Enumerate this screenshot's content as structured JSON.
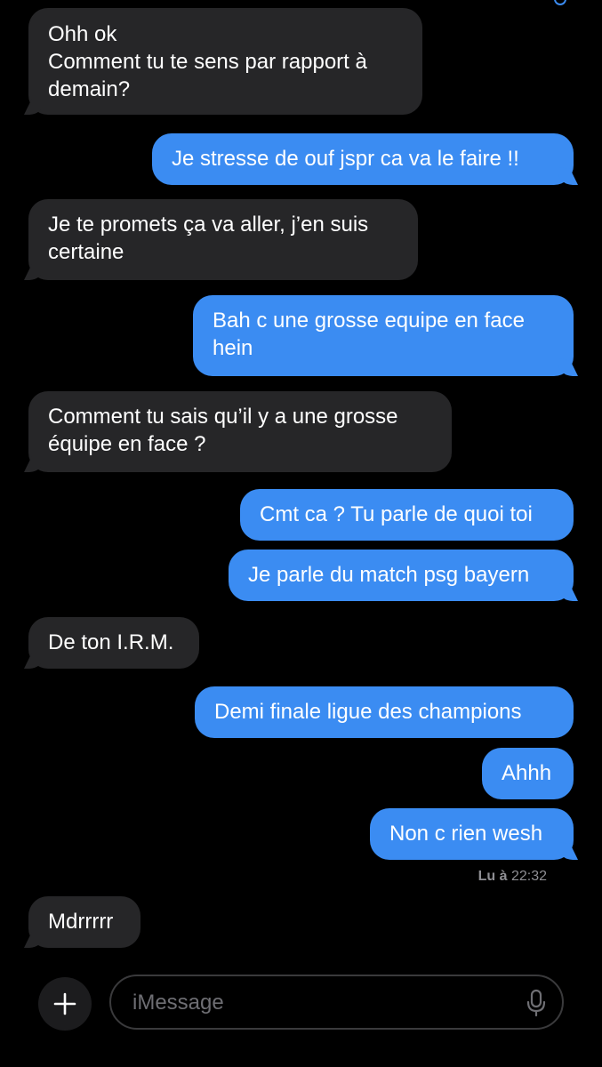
{
  "messages": [
    {
      "id": "m1",
      "from": "them",
      "lines": [
        "Ohh ok",
        "Comment tu te sens par rapport à",
        "demain?"
      ]
    },
    {
      "id": "m2",
      "from": "me",
      "lines": [
        "Je stresse de ouf jspr ca va le faire !!"
      ]
    },
    {
      "id": "m3",
      "from": "them",
      "lines": [
        "Je te promets ça va aller, j’en suis",
        "certaine"
      ]
    },
    {
      "id": "m4",
      "from": "me",
      "lines": [
        "Bah c une grosse equipe en face",
        "hein"
      ]
    },
    {
      "id": "m5",
      "from": "them",
      "lines": [
        "Comment tu sais qu’il y a une grosse",
        "équipe en face ?"
      ]
    },
    {
      "id": "m6",
      "from": "me",
      "lines": [
        "Cmt ca ? Tu parle de quoi toi"
      ]
    },
    {
      "id": "m7",
      "from": "me",
      "lines": [
        "Je parle du match psg bayern"
      ]
    },
    {
      "id": "m8",
      "from": "them",
      "lines": [
        "De ton I.R.M."
      ]
    },
    {
      "id": "m9",
      "from": "me",
      "lines": [
        "Demi finale ligue des champions"
      ]
    },
    {
      "id": "m10",
      "from": "me",
      "lines": [
        "Ahhh"
      ]
    },
    {
      "id": "m11",
      "from": "me",
      "lines": [
        "Non c rien wesh"
      ]
    },
    {
      "id": "m12",
      "from": "them",
      "lines": [
        "Mdrrrrr"
      ]
    }
  ],
  "read_receipt": {
    "label": "Lu à",
    "time": "22:32"
  },
  "composer": {
    "placeholder": "iMessage",
    "plus_icon": "plus-icon",
    "mic_icon": "microphone-icon"
  },
  "colors": {
    "sent_bubble": "#3b8cf2",
    "received_bubble": "#262628",
    "background": "#000000"
  }
}
